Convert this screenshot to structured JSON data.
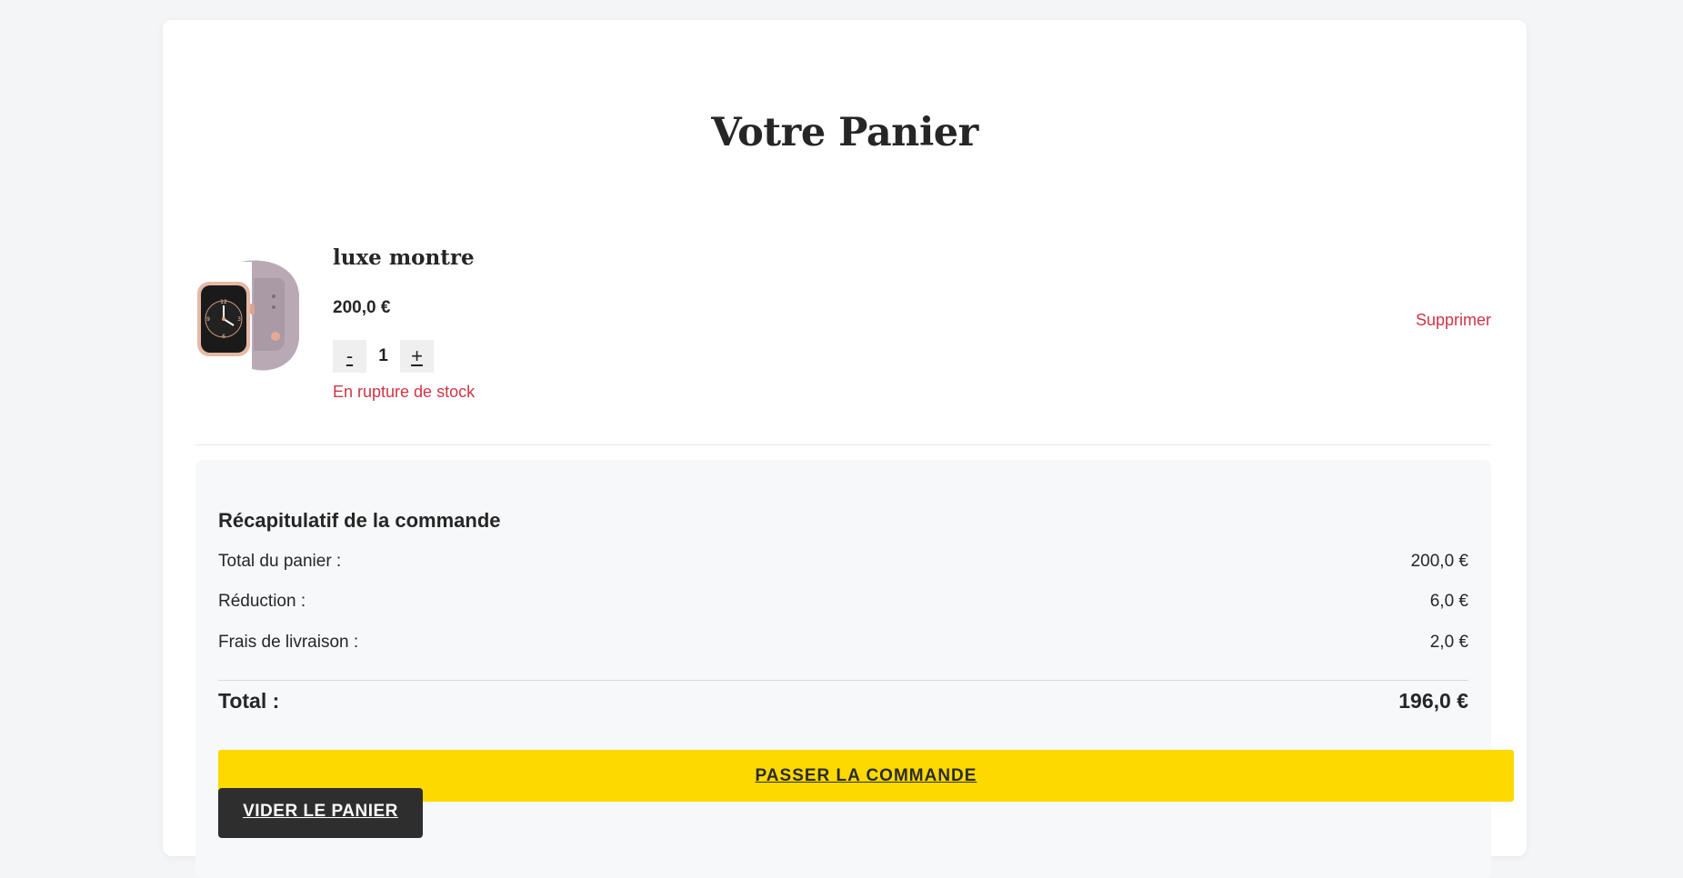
{
  "page": {
    "title": "Votre Panier"
  },
  "cart_item": {
    "name": "luxe montre",
    "price": "200,0 €",
    "decrement_label": "-",
    "quantity": "1",
    "increment_label": "+",
    "stock_status": "En rupture de stock",
    "remove_label": "Supprimer",
    "image_icon": "smartwatch-image"
  },
  "summary": {
    "title": "Récapitulatif de la commande",
    "rows": [
      {
        "label": "Total du panier :",
        "value": "200,0 €"
      },
      {
        "label": "Réduction :",
        "value": "6,0 €"
      },
      {
        "label": "Frais de livraison :",
        "value": "2,0 €"
      }
    ],
    "total_label": "Total :",
    "total_value": "196,0 €",
    "checkout_label": "PASSER LA COMMANDE",
    "clear_label": "VIDER LE PANIER"
  },
  "colors": {
    "accent_yellow": "#fdd900",
    "danger_red": "#cf3545",
    "dark_button": "#2e2e2e"
  }
}
